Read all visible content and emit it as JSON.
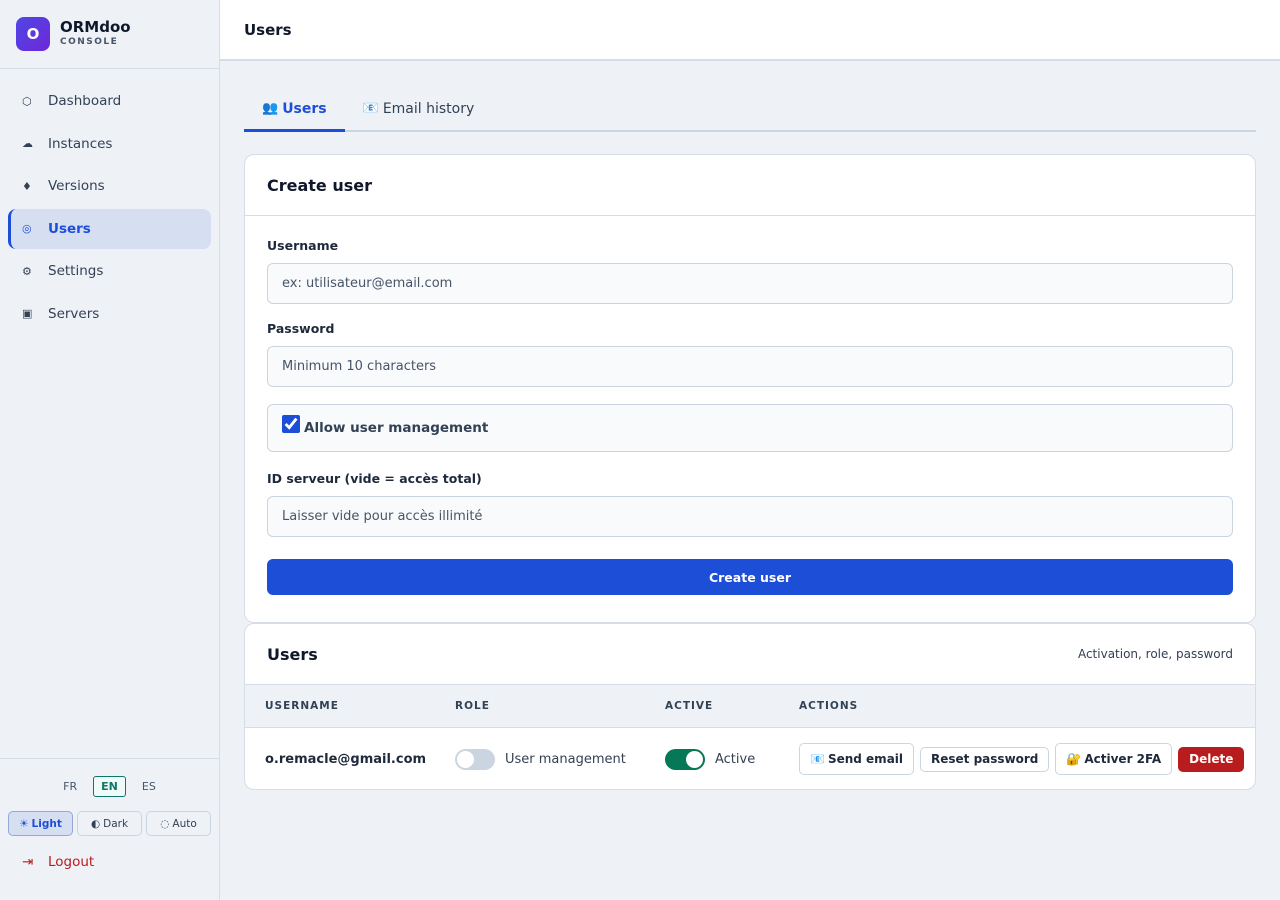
{
  "brand": {
    "logo_letter": "O",
    "name": "ORMdoo",
    "subtitle": "CONSOLE"
  },
  "sidebar": {
    "items": [
      {
        "label": "Dashboard",
        "icon": "hexagon-icon",
        "glyph": "⬡",
        "active": false
      },
      {
        "label": "Instances",
        "icon": "cloud-icon",
        "glyph": "☁",
        "active": false
      },
      {
        "label": "Versions",
        "icon": "diamond-icon",
        "glyph": "♦",
        "active": false
      },
      {
        "label": "Users",
        "icon": "target-icon",
        "glyph": "◎",
        "active": true
      },
      {
        "label": "Settings",
        "icon": "gear-icon",
        "glyph": "⚙",
        "active": false
      },
      {
        "label": "Servers",
        "icon": "server-icon",
        "glyph": "▣",
        "active": false
      }
    ],
    "languages": [
      "FR",
      "EN",
      "ES"
    ],
    "active_language": "EN",
    "themes": [
      {
        "label": "Light",
        "glyph": "☀",
        "active": true
      },
      {
        "label": "Dark",
        "glyph": "◐",
        "active": false
      },
      {
        "label": "Auto",
        "glyph": "◌",
        "active": false
      }
    ],
    "logout_label": "Logout",
    "logout_glyph": "⇥"
  },
  "header": {
    "title": "Users"
  },
  "tabs": [
    {
      "label": "Users",
      "glyph": "👥",
      "active": true
    },
    {
      "label": "Email history",
      "glyph": "📧",
      "active": false
    }
  ],
  "create_form": {
    "title": "Create user",
    "username_label": "Username",
    "username_placeholder": "ex: utilisateur@email.com",
    "password_label": "Password",
    "password_placeholder": "Minimum 10 characters",
    "allow_management_label": "Allow user management",
    "allow_management_checked": true,
    "server_label": "ID serveur (vide = accès total)",
    "server_placeholder": "Laisser vide pour accès illimité",
    "submit_label": "Create user"
  },
  "users_table": {
    "title": "Users",
    "subtitle": "Activation, role, password",
    "columns": [
      "USERNAME",
      "ROLE",
      "ACTIVE",
      "ACTIONS"
    ],
    "rows": [
      {
        "username": "o.remacle@gmail.com",
        "role_label": "User management",
        "role_on": false,
        "active_label": "Active",
        "active_on": true,
        "send_email_label": "Send email",
        "send_email_glyph": "📧",
        "reset_password_label": "Reset password",
        "enable_2fa_label": "Activer 2FA",
        "enable_2fa_glyph": "🔐",
        "delete_label": "Delete"
      }
    ]
  },
  "colors": {
    "accent": "#1d4ed8",
    "danger": "#b91c1c",
    "success": "#047857"
  }
}
